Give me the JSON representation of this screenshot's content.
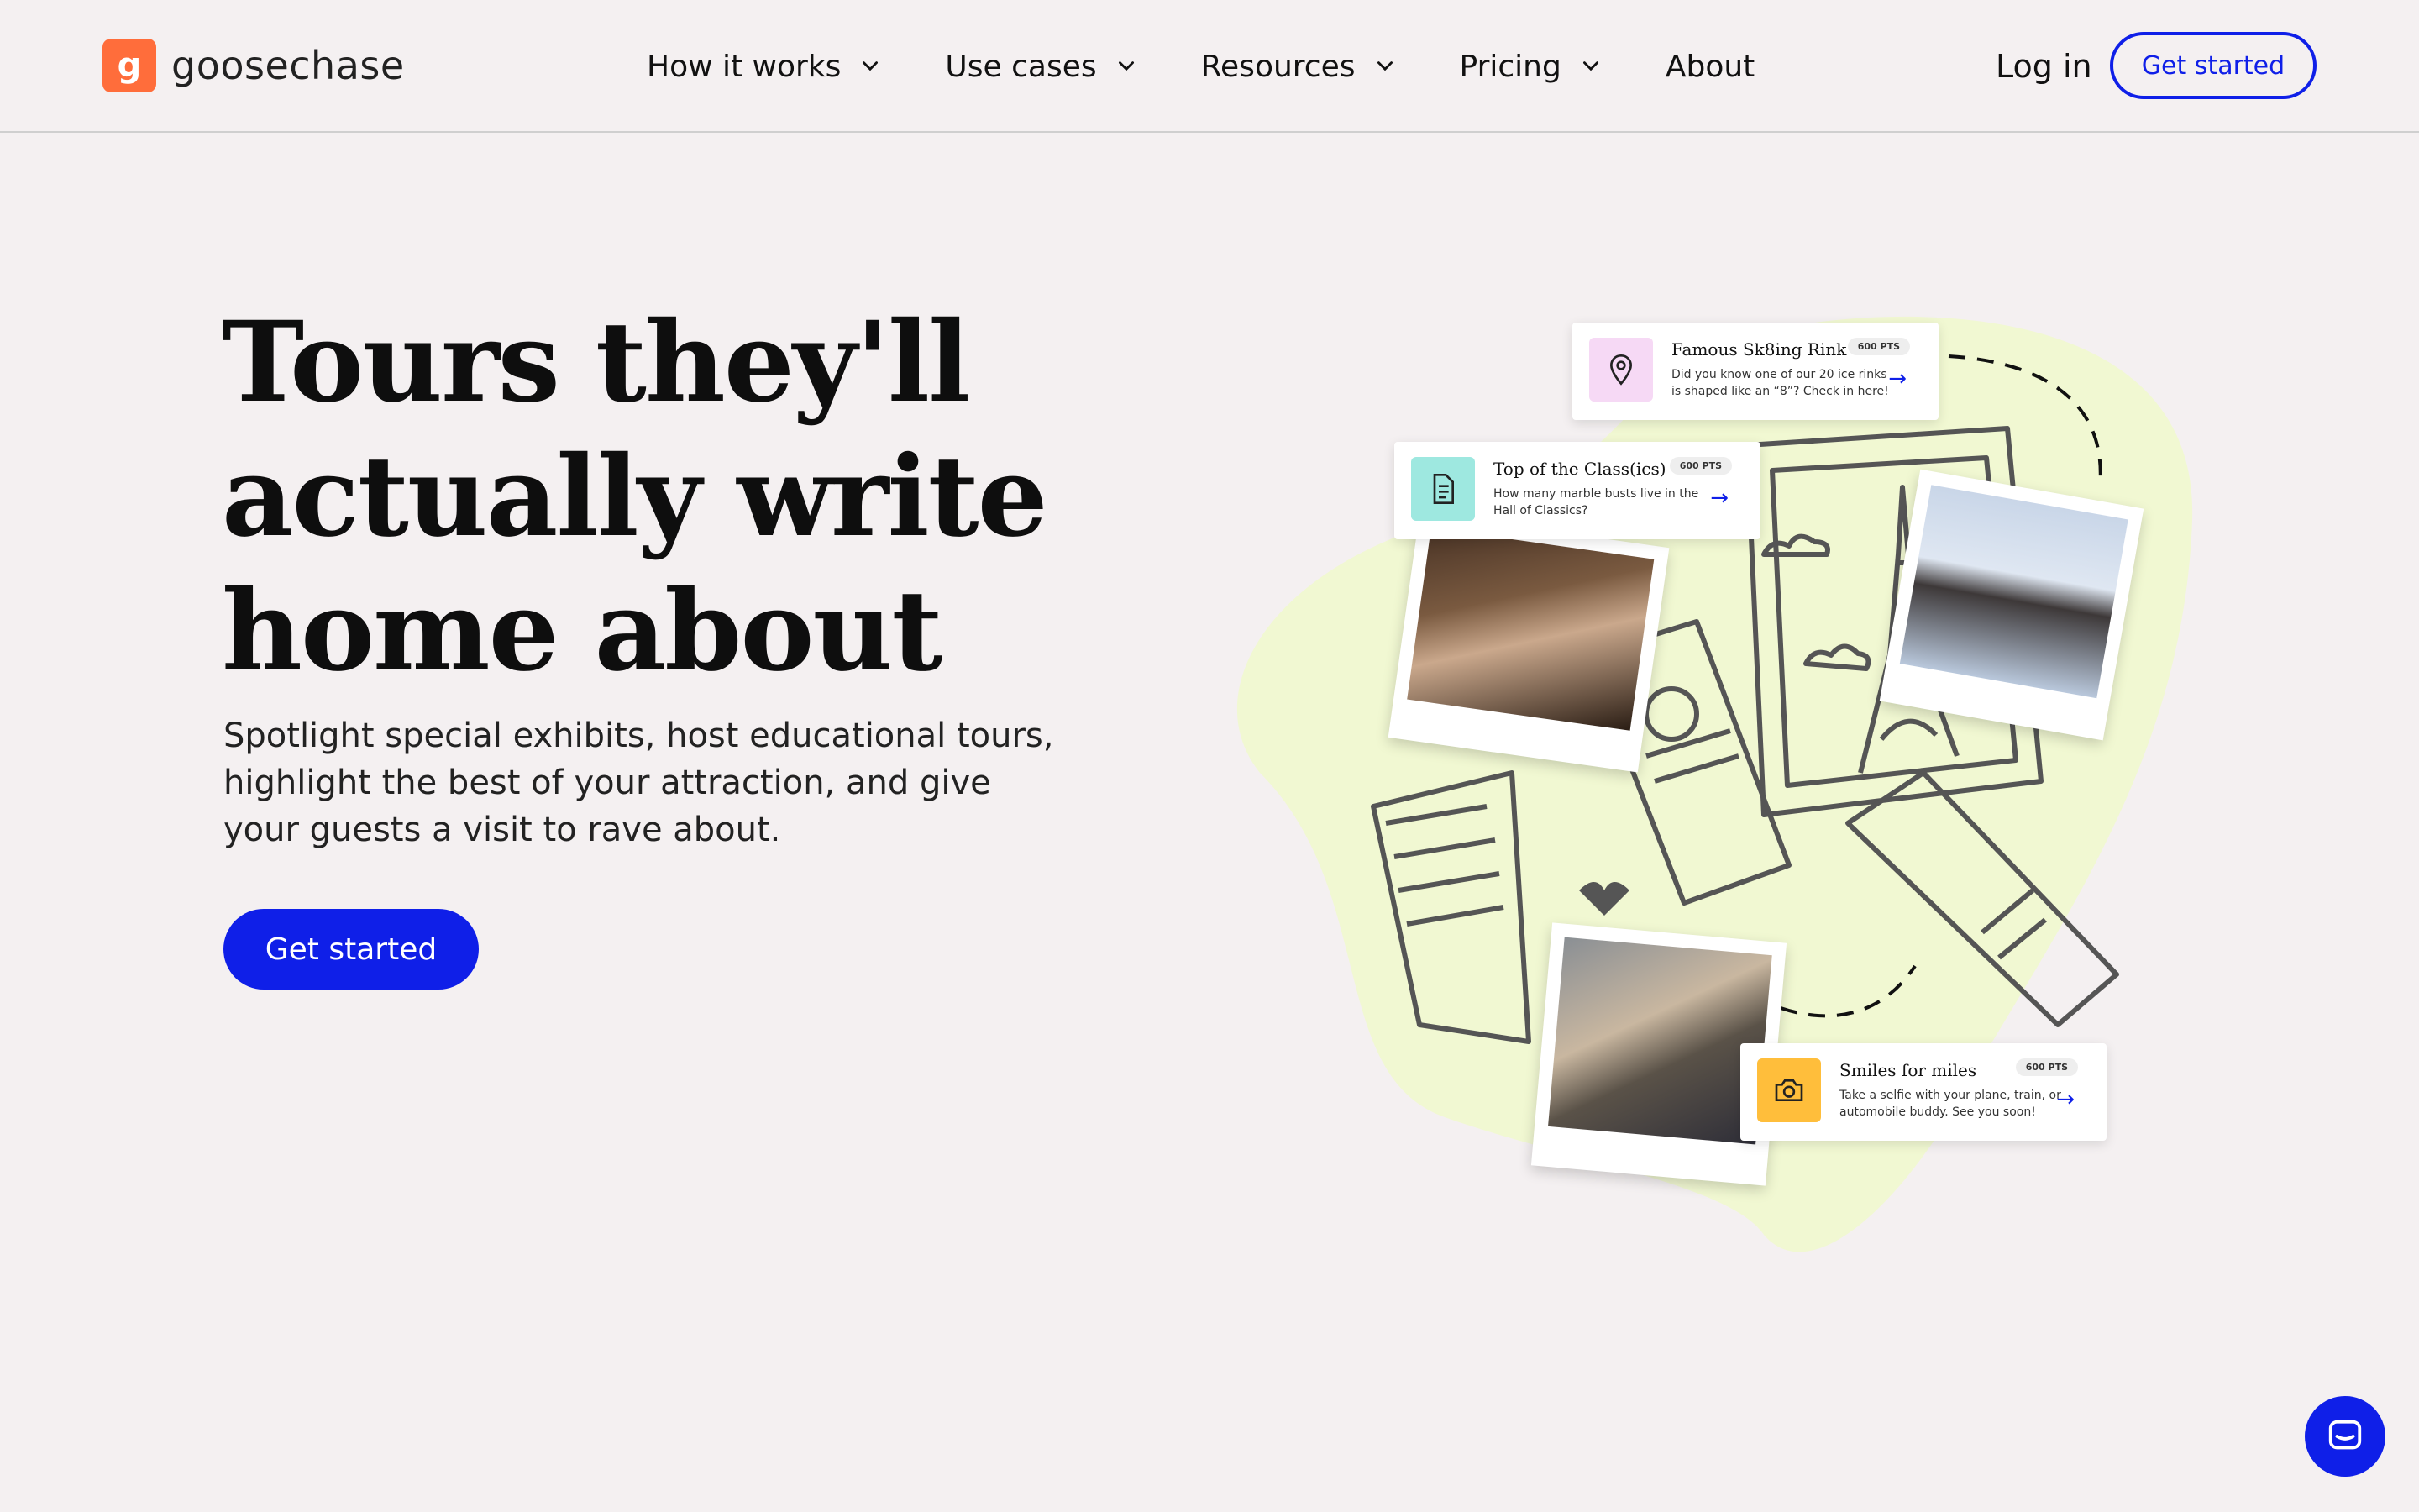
{
  "brand": {
    "logo_letter": "g",
    "name": "goosechase",
    "accent": "#ff6d3b",
    "primary": "#0f1fe8",
    "blob": "#f1f8d2"
  },
  "nav": {
    "items": [
      {
        "label": "How it works",
        "has_dropdown": true
      },
      {
        "label": "Use cases",
        "has_dropdown": true
      },
      {
        "label": "Resources",
        "has_dropdown": true
      },
      {
        "label": "Pricing",
        "has_dropdown": true
      },
      {
        "label": "About",
        "has_dropdown": false
      }
    ],
    "login_label": "Log in",
    "cta_label": "Get started"
  },
  "hero": {
    "title_lines": [
      "Tours they'll",
      "actually write",
      "home about"
    ],
    "subtitle": "Spotlight special exhibits, host educational tours, highlight the best of your attraction, and give your guests a visit to rave about.",
    "cta_label": "Get started"
  },
  "missions": [
    {
      "title": "Famous Sk8ing Rink",
      "points": "600 PTS",
      "desc": "Did you know one of our 20 ice rinks is shaped like an “8”? Check in here!",
      "icon": "location-pin-icon",
      "icon_bg": "#f6d9f5"
    },
    {
      "title": "Top of the Class(ics)",
      "points": "600 PTS",
      "desc": "How many marble busts live in the Hall of Classics?",
      "icon": "document-icon",
      "icon_bg": "#9ee8e0"
    },
    {
      "title": "Smiles for miles",
      "points": "600 PTS",
      "desc": "Take a selfie with your plane, train, or automobile buddy. See you soon!",
      "icon": "camera-icon",
      "icon_bg": "#ffbe3b"
    }
  ],
  "chat": {
    "icon": "chat-icon"
  }
}
